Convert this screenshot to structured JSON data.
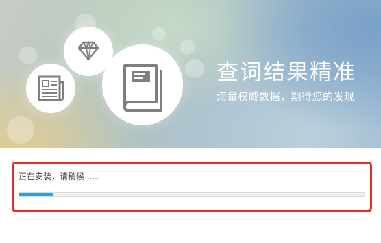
{
  "banner": {
    "title": "查词结果精准",
    "subtitle": "海量权威数据，期待您的发现",
    "icons": [
      "newspaper-icon",
      "diamond-icon",
      "book-icon"
    ]
  },
  "install": {
    "status_text": "正在安装，请稍候......",
    "progress_fraction": 0.1
  },
  "colors": {
    "progress_fill": "#2f9fe0",
    "highlight_border": "#e0322a",
    "icon_gray": "#7f7f7f"
  }
}
